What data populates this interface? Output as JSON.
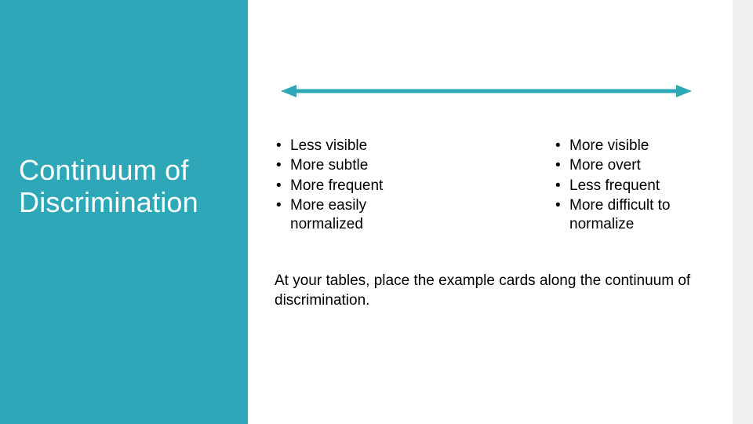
{
  "title": "Continuum of Discrimination",
  "arrow_color": "#2ea8b8",
  "left_list": {
    "items": [
      "Less visible",
      "More subtle",
      "More frequent",
      "More easily normalized"
    ]
  },
  "right_list": {
    "items": [
      "More visible",
      "More overt",
      "Less frequent",
      "More difficult to normalize"
    ]
  },
  "instruction": "At your tables, place the example cards along the continuum of discrimination."
}
